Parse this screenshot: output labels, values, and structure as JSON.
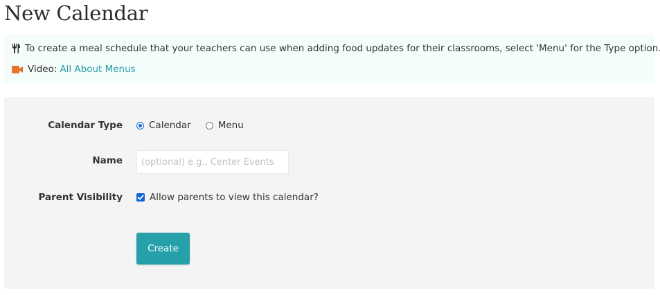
{
  "page": {
    "title": "New Calendar"
  },
  "info": {
    "utensils_icon": "utensils-icon",
    "message": "To create a meal schedule that your teachers can use when adding food updates for their classrooms, select 'Menu' for the Type option.",
    "video_icon": "video-camera-icon",
    "video_label": "Video:",
    "video_link": "All About Menus"
  },
  "form": {
    "type_label": "Calendar Type",
    "type_options": [
      {
        "label": "Calendar",
        "selected": true
      },
      {
        "label": "Menu",
        "selected": false
      }
    ],
    "name_label": "Name",
    "name_placeholder": "(optional) e.g., Center Events",
    "name_value": "",
    "visibility_label": "Parent Visibility",
    "visibility_checkbox_label": "Allow parents to view this calendar?",
    "visibility_checked": true,
    "create_label": "Create"
  },
  "colors": {
    "accent": "#26a1a9",
    "link": "#2a9ca6",
    "video_icon": "#e8742a",
    "control": "#0f65d8",
    "info_bg": "#f4fdfc",
    "panel_bg": "#f4f4f4"
  }
}
